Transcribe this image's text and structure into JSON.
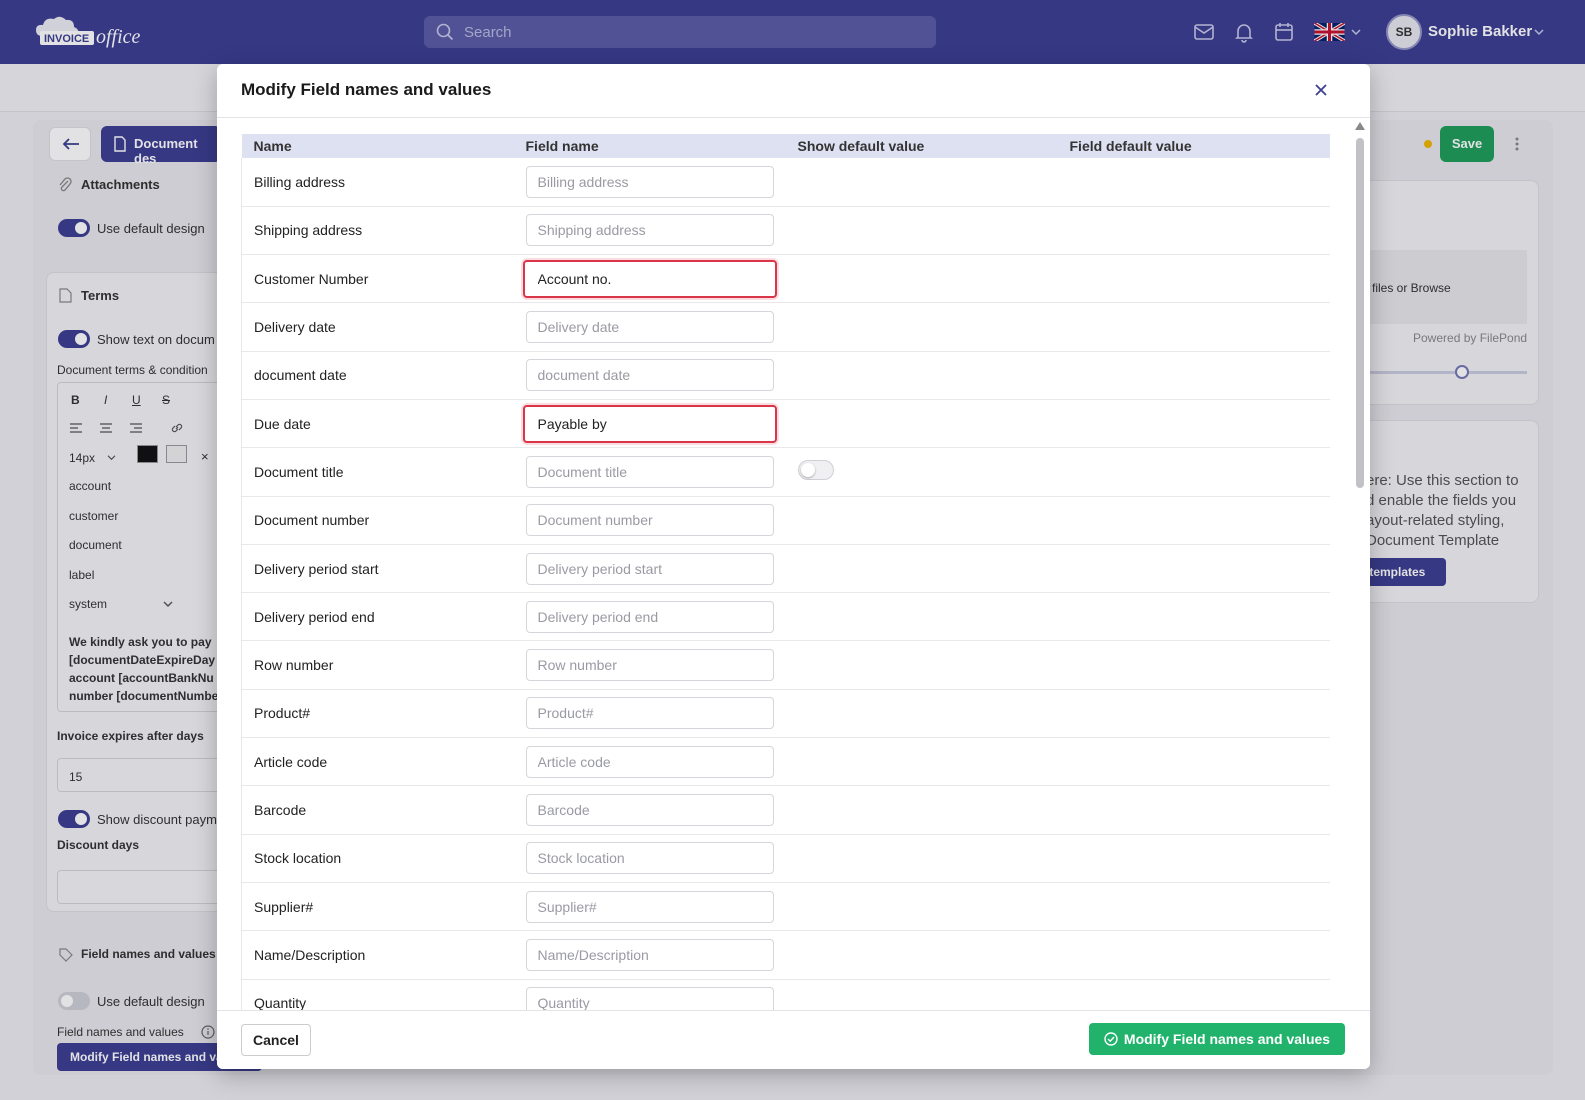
{
  "app": {
    "user_initials": "SB",
    "user_name": "Sophie Bakker",
    "search_placeholder": "Search"
  },
  "background": {
    "document_design_label": "Document des",
    "save_label": "Save",
    "attachments_label": "Attachments",
    "use_default_design_1": "Use default design",
    "terms_label": "Terms",
    "show_text_label": "Show text on docum",
    "doc_terms_label": "Document terms & condition",
    "font_size": "14px",
    "field_items": [
      "account",
      "customer",
      "document",
      "label",
      "system"
    ],
    "terms_text": [
      "We kindly ask you to pay",
      "[documentDateExpireDay",
      "account [accountBankNu",
      "number [documentNumbe"
    ],
    "invoice_expires_label": "Invoice expires after days",
    "invoice_expires_value": "15",
    "show_discount_label": "Show discount paym",
    "discount_days_label": "Discount days",
    "field_names_section_label": "Field names and values",
    "use_default_design_2": "Use default design",
    "field_names_label": "Field names and values",
    "modify_button_bg": "Modify Field names and va",
    "right_upload_text": "files or Browse",
    "powered_by": "Powered by FilePond",
    "right_help_text": [
      "ere: Use this section to",
      "d enable the fields you",
      "ayout-related styling,",
      "Document Template"
    ],
    "templates_btn": "t templates"
  },
  "modal": {
    "title": "Modify Field names and values",
    "columns": {
      "name": "Name",
      "field_name": "Field name",
      "show_default": "Show default value",
      "field_default": "Field default value"
    },
    "rows": [
      {
        "name": "Billing address",
        "placeholder": "Billing address",
        "value": ""
      },
      {
        "name": "Shipping address",
        "placeholder": "Shipping address",
        "value": ""
      },
      {
        "name": "Customer Number",
        "placeholder": "Customer Number",
        "value": "Account no.",
        "highlight": true
      },
      {
        "name": "Delivery date",
        "placeholder": "Delivery date",
        "value": ""
      },
      {
        "name": "document date",
        "placeholder": "document date",
        "value": ""
      },
      {
        "name": "Due date",
        "placeholder": "Due date",
        "value": "Payable by",
        "highlight": true
      },
      {
        "name": "Document title",
        "placeholder": "Document title",
        "value": "",
        "toggle": true
      },
      {
        "name": "Document number",
        "placeholder": "Document number",
        "value": ""
      },
      {
        "name": "Delivery period start",
        "placeholder": "Delivery period start",
        "value": ""
      },
      {
        "name": "Delivery period end",
        "placeholder": "Delivery period end",
        "value": ""
      },
      {
        "name": "Row number",
        "placeholder": "Row number",
        "value": ""
      },
      {
        "name": "Product#",
        "placeholder": "Product#",
        "value": ""
      },
      {
        "name": "Article code",
        "placeholder": "Article code",
        "value": ""
      },
      {
        "name": "Barcode",
        "placeholder": "Barcode",
        "value": ""
      },
      {
        "name": "Stock location",
        "placeholder": "Stock location",
        "value": ""
      },
      {
        "name": "Supplier#",
        "placeholder": "Supplier#",
        "value": ""
      },
      {
        "name": "Name/Description",
        "placeholder": "Name/Description",
        "value": ""
      },
      {
        "name": "Quantity",
        "placeholder": "Quantity",
        "value": ""
      }
    ],
    "cancel_label": "Cancel",
    "submit_label": "Modify Field names and values"
  },
  "colors": {
    "nav": "#3c3e92",
    "accent_green": "#21b36b",
    "highlight_red": "#d9364a"
  }
}
